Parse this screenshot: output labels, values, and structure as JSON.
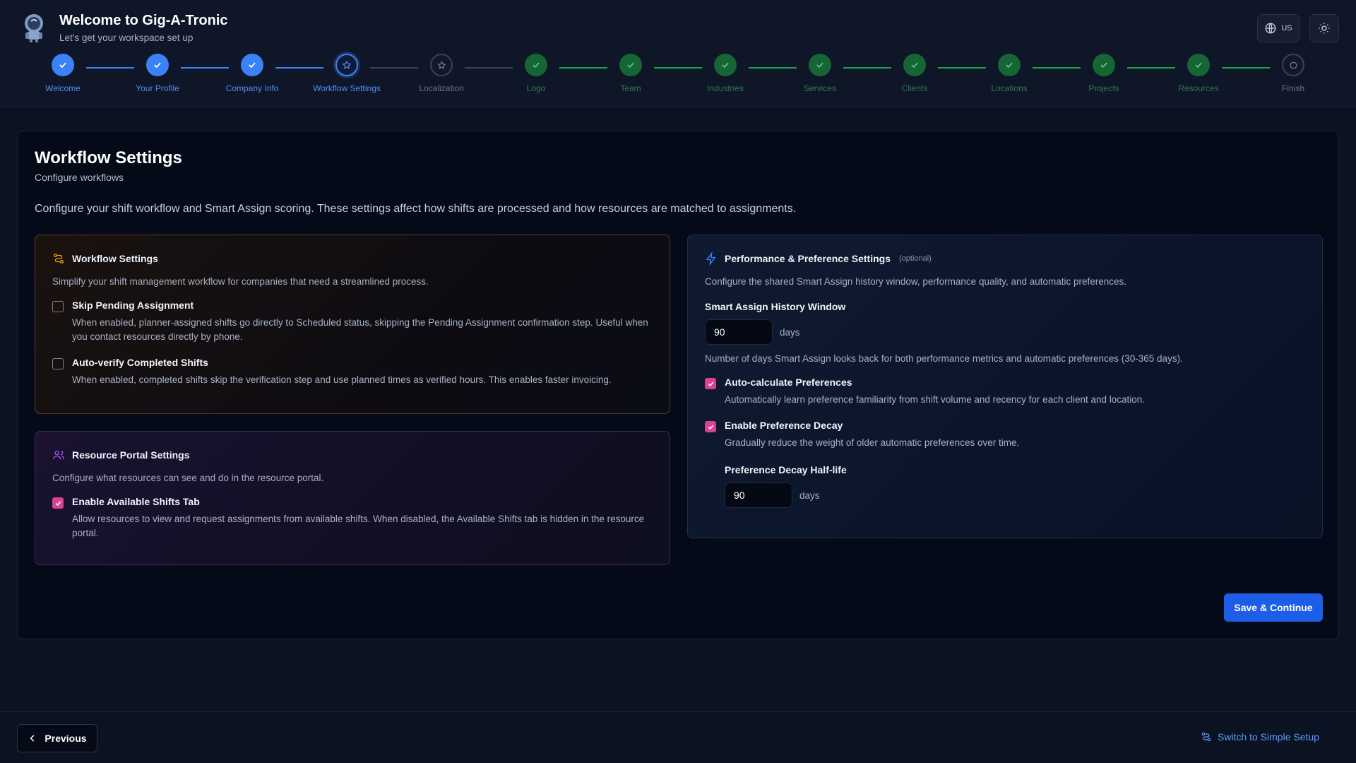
{
  "header": {
    "title": "Welcome to Gig-A-Tronic",
    "subtitle": "Let's get your workspace set up",
    "language_label": "US",
    "language_icon": "globe-icon",
    "theme_icon": "sun-icon"
  },
  "stepper": {
    "steps": [
      {
        "label": "Welcome",
        "state": "done-blue"
      },
      {
        "label": "Your Profile",
        "state": "done-blue"
      },
      {
        "label": "Company Info",
        "state": "done-blue"
      },
      {
        "label": "Workflow Settings",
        "state": "current"
      },
      {
        "label": "Localization",
        "state": "pending-star"
      },
      {
        "label": "Logo",
        "state": "done-green"
      },
      {
        "label": "Team",
        "state": "done-green"
      },
      {
        "label": "Industries",
        "state": "done-green"
      },
      {
        "label": "Services",
        "state": "done-green"
      },
      {
        "label": "Clients",
        "state": "done-green"
      },
      {
        "label": "Locations",
        "state": "done-green"
      },
      {
        "label": "Projects",
        "state": "done-green"
      },
      {
        "label": "Resources",
        "state": "done-green"
      },
      {
        "label": "Finish",
        "state": "pending-circle"
      }
    ]
  },
  "page": {
    "title": "Workflow Settings",
    "subtitle": "Configure workflows",
    "description": "Configure your shift workflow and Smart Assign scoring. These settings affect how shifts are processed and how resources are matched to assignments."
  },
  "workflow_panel": {
    "title": "Workflow Settings",
    "description": "Simplify your shift management workflow for companies that need a streamlined process.",
    "options": [
      {
        "title": "Skip Pending Assignment",
        "checked": false,
        "description": "When enabled, planner-assigned shifts go directly to Scheduled status, skipping the Pending Assignment confirmation step. Useful when you contact resources directly by phone."
      },
      {
        "title": "Auto-verify Completed Shifts",
        "checked": false,
        "description": "When enabled, completed shifts skip the verification step and use planned times as verified hours. This enables faster invoicing."
      }
    ]
  },
  "portal_panel": {
    "title": "Resource Portal Settings",
    "description": "Configure what resources can see and do in the resource portal.",
    "options": [
      {
        "title": "Enable Available Shifts Tab",
        "checked": true,
        "description": "Allow resources to view and request assignments from available shifts. When disabled, the Available Shifts tab is hidden in the resource portal."
      }
    ]
  },
  "perf_panel": {
    "title": "Performance & Preference Settings",
    "optional_tag": "(optional)",
    "description": "Configure the shared Smart Assign history window, performance quality, and automatic preferences.",
    "history_label": "Smart Assign History Window",
    "history_value": "90",
    "history_unit": "days",
    "history_help": "Number of days Smart Assign looks back for both performance metrics and automatic preferences (30-365 days).",
    "auto_calc_title": "Auto-calculate Preferences",
    "auto_calc_checked": true,
    "auto_calc_desc": "Automatically learn preference familiarity from shift volume and recency for each client and location.",
    "decay_title": "Enable Preference Decay",
    "decay_checked": true,
    "decay_desc": "Gradually reduce the weight of older automatic preferences over time.",
    "half_life_label": "Preference Decay Half-life",
    "half_life_value": "90",
    "half_life_unit": "days"
  },
  "actions": {
    "save_label": "Save & Continue"
  },
  "footer": {
    "previous_label": "Previous",
    "switch_label": "Switch to Simple Setup"
  },
  "colors": {
    "accent_blue": "#3b82f6",
    "done_green": "#166534",
    "checkbox_pink": "#d9438c",
    "save_button": "#1d5ee8"
  }
}
